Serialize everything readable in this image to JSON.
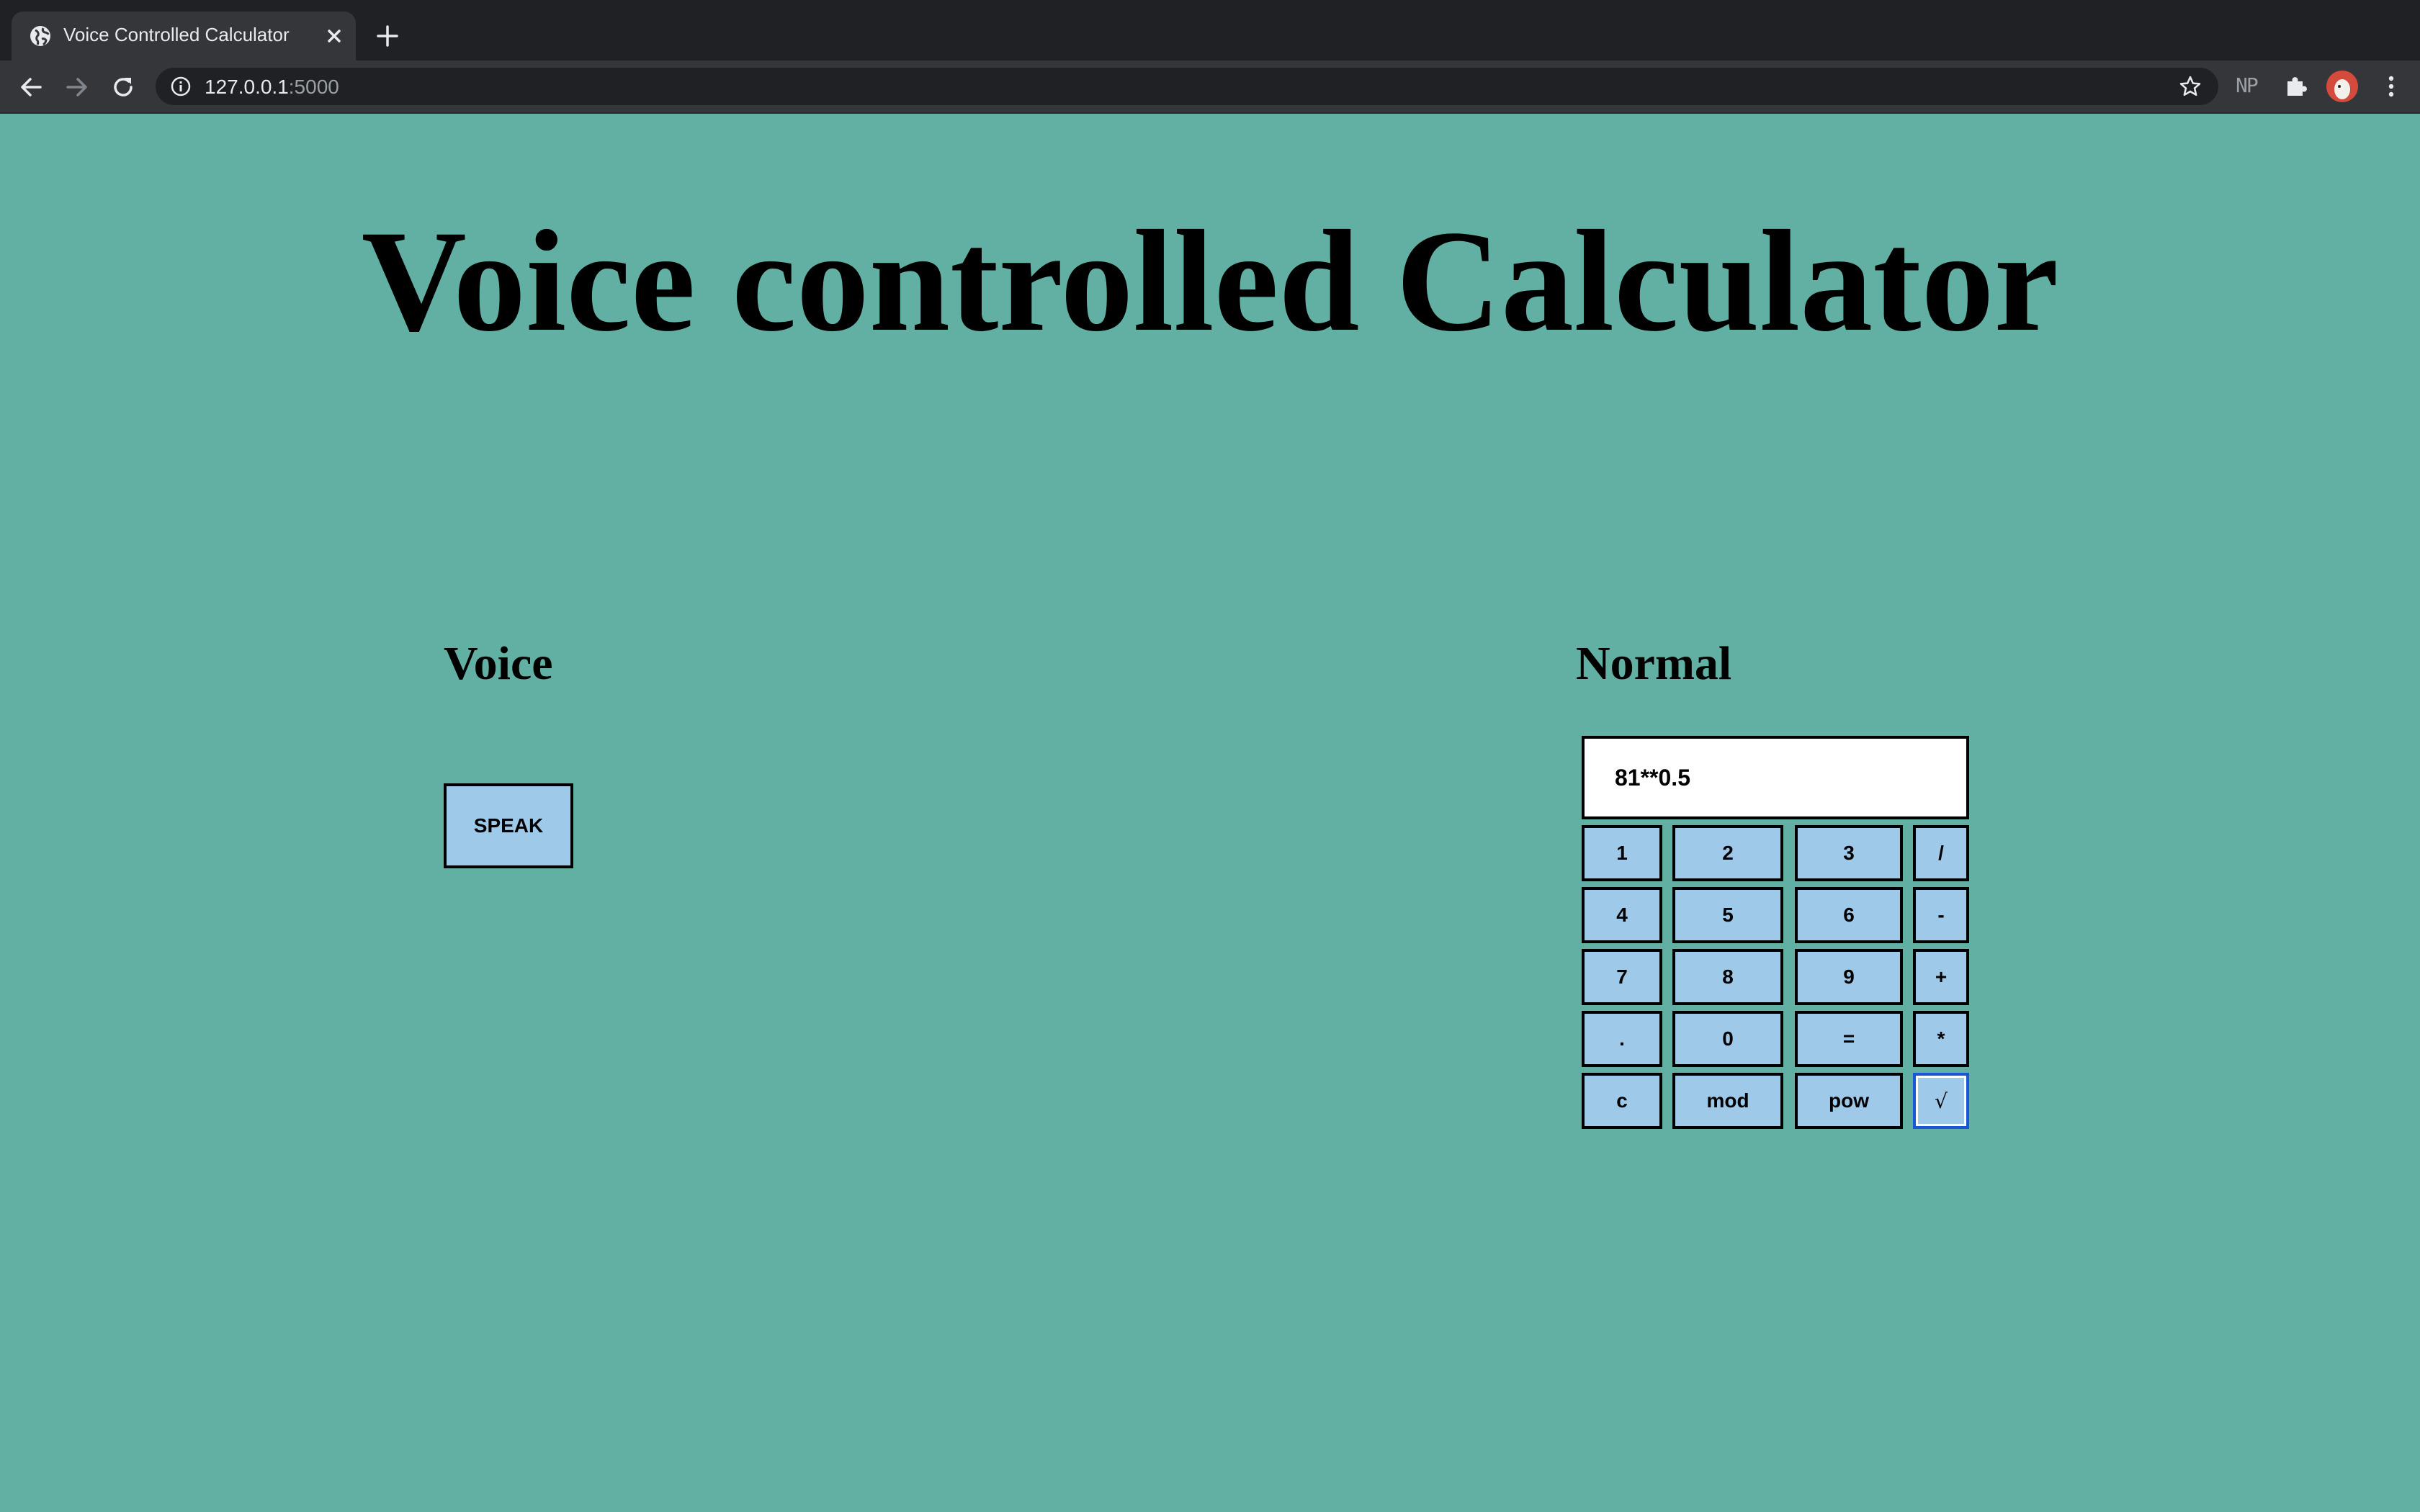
{
  "browser": {
    "tab_title": "Voice Controlled Calculator",
    "url_host": "127.0.0.1",
    "url_port": ":5000",
    "extension_label": "NP"
  },
  "page": {
    "title": "Voice controlled Calculator",
    "voice_heading": "Voice",
    "normal_heading": "Normal",
    "speak_label": "SPEAK"
  },
  "calculator": {
    "display_value": "81**0.5",
    "keys": {
      "k1": "1",
      "k2": "2",
      "k3": "3",
      "div": "/",
      "k4": "4",
      "k5": "5",
      "k6": "6",
      "minus": "-",
      "k7": "7",
      "k8": "8",
      "k9": "9",
      "plus": "+",
      "dot": ".",
      "k0": "0",
      "equals": "=",
      "mul": "*",
      "clear": "c",
      "mod": "mod",
      "pow": "pow",
      "sqrt": "√"
    }
  },
  "colors": {
    "page_background": "#62b0a3",
    "button_fill": "#9ec9e9",
    "focus_ring": "#1a57d6"
  }
}
